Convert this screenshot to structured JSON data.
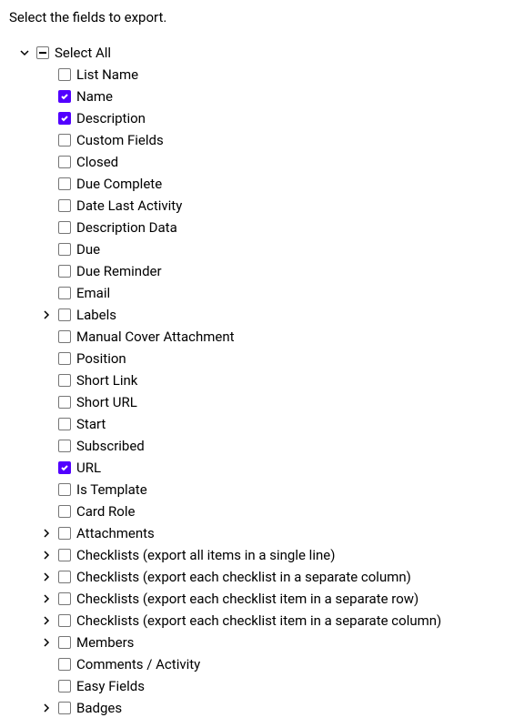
{
  "header": {
    "text": "Select the fields to export."
  },
  "root": {
    "label": "Select All"
  },
  "items": [
    {
      "label": "List Name",
      "checked": false,
      "expandable": false
    },
    {
      "label": "Name",
      "checked": true,
      "expandable": false
    },
    {
      "label": "Description",
      "checked": true,
      "expandable": false
    },
    {
      "label": "Custom Fields",
      "checked": false,
      "expandable": false
    },
    {
      "label": "Closed",
      "checked": false,
      "expandable": false
    },
    {
      "label": "Due Complete",
      "checked": false,
      "expandable": false
    },
    {
      "label": "Date Last Activity",
      "checked": false,
      "expandable": false
    },
    {
      "label": "Description Data",
      "checked": false,
      "expandable": false
    },
    {
      "label": "Due",
      "checked": false,
      "expandable": false
    },
    {
      "label": "Due Reminder",
      "checked": false,
      "expandable": false
    },
    {
      "label": "Email",
      "checked": false,
      "expandable": false
    },
    {
      "label": "Labels",
      "checked": false,
      "expandable": true
    },
    {
      "label": "Manual Cover Attachment",
      "checked": false,
      "expandable": false
    },
    {
      "label": "Position",
      "checked": false,
      "expandable": false
    },
    {
      "label": "Short Link",
      "checked": false,
      "expandable": false
    },
    {
      "label": "Short URL",
      "checked": false,
      "expandable": false
    },
    {
      "label": "Start",
      "checked": false,
      "expandable": false
    },
    {
      "label": "Subscribed",
      "checked": false,
      "expandable": false
    },
    {
      "label": "URL",
      "checked": true,
      "expandable": false
    },
    {
      "label": "Is Template",
      "checked": false,
      "expandable": false
    },
    {
      "label": "Card Role",
      "checked": false,
      "expandable": false
    },
    {
      "label": "Attachments",
      "checked": false,
      "expandable": true
    },
    {
      "label": "Checklists (export all items in a single line)",
      "checked": false,
      "expandable": true
    },
    {
      "label": "Checklists (export each checklist in a separate column)",
      "checked": false,
      "expandable": true
    },
    {
      "label": "Checklists (export each checklist item in a separate row)",
      "checked": false,
      "expandable": true
    },
    {
      "label": "Checklists (export each checklist item in a separate column)",
      "checked": false,
      "expandable": true
    },
    {
      "label": "Members",
      "checked": false,
      "expandable": true
    },
    {
      "label": "Comments / Activity",
      "checked": false,
      "expandable": false
    },
    {
      "label": "Easy Fields",
      "checked": false,
      "expandable": false
    },
    {
      "label": "Badges",
      "checked": false,
      "expandable": true
    }
  ]
}
